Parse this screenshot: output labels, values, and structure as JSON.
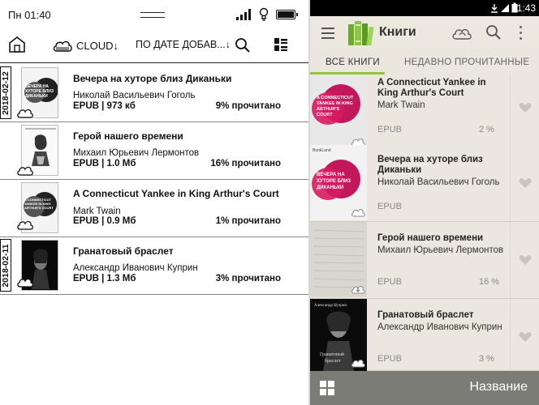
{
  "left": {
    "status": {
      "time": "Пн 01:40"
    },
    "toolbar": {
      "cloud_label": "CLOUD↓",
      "sort_label": "ПО ДАТЕ ДОБАВ...↓"
    },
    "books": [
      {
        "date": "2018-02-12",
        "title": "Вечера на хуторе близ Диканьки",
        "author": "Николай Васильевич Гоголь",
        "meta": "EPUB | 973 кб",
        "progress": "9% прочитано",
        "cover_text": "ВЕЧЕРА НА ХУТОРЕ БЛИЗ ДИКАНЬКИ"
      },
      {
        "date": "",
        "title": "Герой нашего времени",
        "author": "Михаил Юрьевич Лермонтов",
        "meta": "EPUB | 1.0 Мб",
        "progress": "16% прочитано",
        "cover_text": ""
      },
      {
        "date": "",
        "title": "A Connecticut Yankee in King Arthur's Court",
        "author": "Mark Twain",
        "meta": "EPUB | 0.9 Мб",
        "progress": "1% прочитано",
        "cover_text": "A CONNECTICUT YANKEE IN KING ARTHUR'S COURT"
      },
      {
        "date": "2018-02-11",
        "title": "Гранатовый браслет",
        "author": "Александр Иванович Куприн",
        "meta": "EPUB | 1.3 Мб",
        "progress": "3% прочитано",
        "cover_text": ""
      }
    ]
  },
  "right": {
    "status": {
      "time": "1:43"
    },
    "appbar": {
      "title": "Книги"
    },
    "tabs": {
      "all": "ВСЕ КНИГИ",
      "recent": "НЕДАВНО ПРОЧИТАННЫЕ"
    },
    "books": [
      {
        "title": "A Connecticut Yankee in King Arthur's Court",
        "author": "Mark Twain",
        "format": "EPUB",
        "progress": "2 %",
        "cover_text": "A CONNECTICUT YANKEE IN KING ARTHUR'S COURT"
      },
      {
        "title": "Вечера на хуторе близ Диканьки",
        "author": "Николай Васильевич Гоголь",
        "format": "EPUB",
        "progress": "",
        "cover_text": "ВЕЧЕРА НА ХУТОРЕ БЛИЗ ДИКАНЬКИ",
        "publisher": "BookLand"
      },
      {
        "title": "Герой нашего времени",
        "author": "Михаил Юрьевич Лермонтов",
        "format": "EPUB",
        "progress": "16 %",
        "cover_text": ""
      },
      {
        "title": "Гранатовый браслет",
        "author": "Александр Иванович Куприн",
        "format": "EPUB",
        "progress": "3 %",
        "cover_text": "Гранатовый браслет",
        "cover_author": "Александр Куприн"
      }
    ],
    "bottom": {
      "sort_label": "Название"
    }
  },
  "colors": {
    "accent_green": "#8cc63f",
    "cover_pink": "#c2185b",
    "bottom_bar": "#7c7c76"
  },
  "icons": [
    "home-icon",
    "cloud-icon",
    "search-icon",
    "view-mode-icon",
    "menu-icon",
    "books-logo-icon",
    "more-icon",
    "heart-icon",
    "grid-icon",
    "signal-icon",
    "bulb-icon",
    "battery-icon"
  ]
}
